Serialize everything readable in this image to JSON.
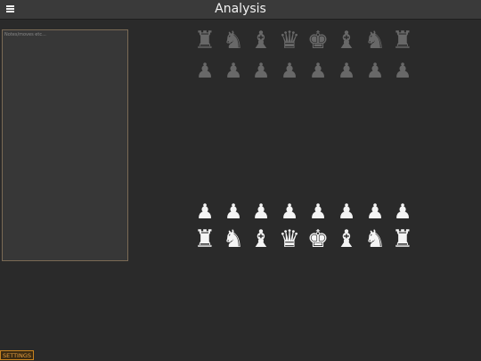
{
  "header": {
    "menu_icon": "hamburger-menu-icon",
    "title": "Analysis"
  },
  "notes": {
    "placeholder": "Notes/moves etc...",
    "value": ""
  },
  "board": {
    "black_back_rank": [
      {
        "piece": "rook",
        "glyph": "♜"
      },
      {
        "piece": "knight",
        "glyph": "♞"
      },
      {
        "piece": "bishop",
        "glyph": "♝"
      },
      {
        "piece": "queen",
        "glyph": "♛"
      },
      {
        "piece": "king",
        "glyph": "♚"
      },
      {
        "piece": "bishop",
        "glyph": "♝"
      },
      {
        "piece": "knight",
        "glyph": "♞"
      },
      {
        "piece": "rook",
        "glyph": "♜"
      }
    ],
    "black_pawns": [
      "♟",
      "♟",
      "♟",
      "♟",
      "♟",
      "♟",
      "♟",
      "♟"
    ],
    "white_pawns": [
      "♟",
      "♟",
      "♟",
      "♟",
      "♟",
      "♟",
      "♟",
      "♟"
    ],
    "white_back_rank": [
      {
        "piece": "rook",
        "glyph": "♜"
      },
      {
        "piece": "knight",
        "glyph": "♞"
      },
      {
        "piece": "bishop",
        "glyph": "♝"
      },
      {
        "piece": "queen",
        "glyph": "♛"
      },
      {
        "piece": "king",
        "glyph": "♚"
      },
      {
        "piece": "bishop",
        "glyph": "♝"
      },
      {
        "piece": "knight",
        "glyph": "♞"
      },
      {
        "piece": "rook",
        "glyph": "♜"
      }
    ]
  },
  "footer": {
    "settings_label": "SETTINGS"
  },
  "colors": {
    "background": "#2a2a2a",
    "header": "#3a3a3a",
    "black_piece": "#686868",
    "white_piece": "#f4f4f4",
    "accent": "#c8821e"
  }
}
